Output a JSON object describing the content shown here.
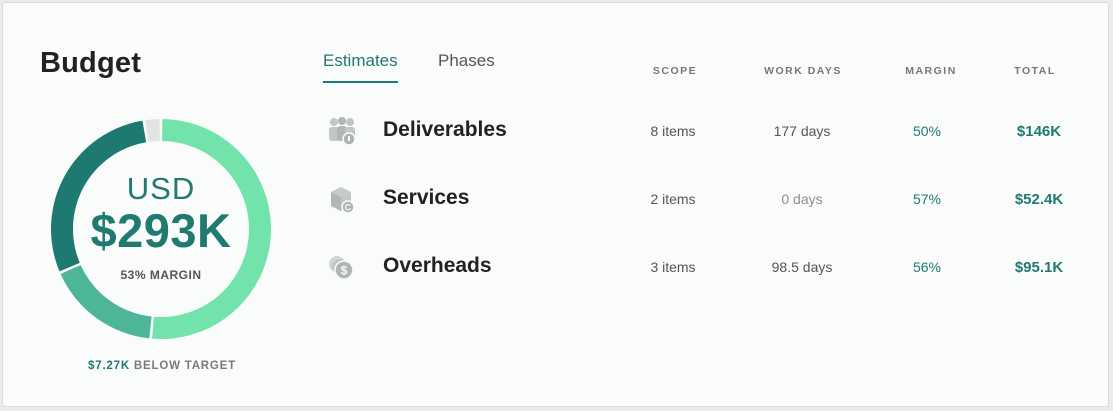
{
  "card": {
    "title": "Budget",
    "currency": "USD",
    "amount": "$293K",
    "margin_label": "53% MARGIN",
    "below_target_value": "$7.27K",
    "below_target_text": " BELOW TARGET"
  },
  "donut": {
    "segments": [
      {
        "name": "light-green",
        "fraction": 0.515,
        "color": "#72e3aa"
      },
      {
        "name": "mid-green",
        "fraction": 0.17,
        "color": "#4db598"
      },
      {
        "name": "dark-teal",
        "fraction": 0.29,
        "color": "#1e7a70"
      },
      {
        "name": "remaining-gray",
        "fraction": 0.025,
        "color": "#e2e5e4"
      }
    ]
  },
  "tabs": [
    {
      "label": "Estimates",
      "active": true
    },
    {
      "label": "Phases",
      "active": false
    }
  ],
  "columns": {
    "scope": "SCOPE",
    "work_days": "WORK DAYS",
    "margin": "MARGIN",
    "total": "TOTAL"
  },
  "rows": [
    {
      "name": "Deliverables",
      "icon": "people-icon",
      "scope": "8 items",
      "work_days": "177 days",
      "margin": "50%",
      "total": "$146K"
    },
    {
      "name": "Services",
      "icon": "box-icon",
      "scope": "2 items",
      "work_days": "0 days",
      "margin": "57%",
      "total": "$52.4K"
    },
    {
      "name": "Overheads",
      "icon": "coins-icon",
      "scope": "3 items",
      "work_days": "98.5 days",
      "margin": "56%",
      "total": "$95.1K"
    }
  ],
  "colors": {
    "accent": "#1f7a70",
    "icon_gray": "#b9bcbc"
  }
}
